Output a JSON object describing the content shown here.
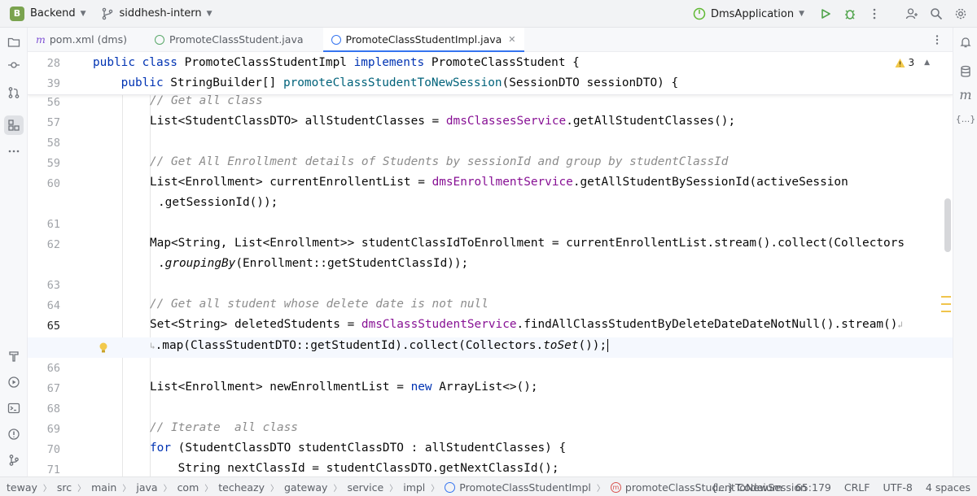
{
  "topbar": {
    "project_letter": "B",
    "project_name": "Backend",
    "branch_name": "siddhesh-intern",
    "run_config": "DmsApplication"
  },
  "tabs": [
    {
      "prefix": "m",
      "label": "pom.xml (dms)"
    },
    {
      "label": "PromoteClassStudent.java"
    },
    {
      "label": "PromoteClassStudentImpl.java",
      "close": "✕"
    }
  ],
  "editor": {
    "warnings_count": "3",
    "sticky": [
      {
        "num": "28"
      },
      {
        "num": "39"
      }
    ],
    "line_numbers": [
      "56",
      "57",
      "58",
      "59",
      "60",
      "",
      "61",
      "62",
      "",
      "63",
      "64",
      "65",
      "",
      "66",
      "67",
      "68",
      "69",
      "70",
      "71"
    ]
  },
  "right_strip": {
    "maven": "m",
    "json": "{...}"
  },
  "statusbar": {
    "crumbs": [
      "teway",
      "src",
      "main",
      "java",
      "com",
      "techeazy",
      "gateway",
      "service",
      "impl",
      "PromoteClassStudentImpl",
      "promoteClassStudentToNewSession"
    ],
    "codeium": "{...} Codeium",
    "position": "65:179",
    "line_sep": "CRLF",
    "encoding": "UTF-8",
    "indent": "4 spaces"
  },
  "colors": {
    "keyword": "#0033b3",
    "comment": "#8c8c8c",
    "field": "#871094",
    "method": "#00627a",
    "accent": "#3574f0",
    "project_badge": "#7aa34f"
  }
}
